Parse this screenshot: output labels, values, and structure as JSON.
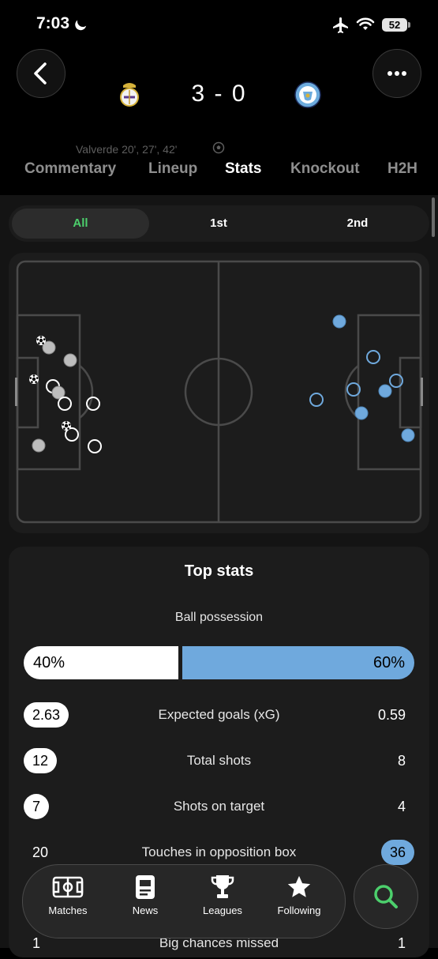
{
  "status_bar": {
    "time": "7:03",
    "battery": "52"
  },
  "match": {
    "score": "3 - 0",
    "scorers": "Valverde 20', 27', 42'"
  },
  "tabs": [
    "Commentary",
    "Lineup",
    "Stats",
    "Knockout",
    "H2H"
  ],
  "active_tab": "Stats",
  "periods": [
    "All",
    "1st",
    "2nd"
  ],
  "active_period": "All",
  "top_stats": {
    "title": "Top stats",
    "possession": {
      "label": "Ball possession",
      "home": "40%",
      "away": "60%",
      "home_fraction": 0.4
    },
    "rows": [
      {
        "label": "Expected goals (xG)",
        "home": "2.63",
        "away": "0.59"
      },
      {
        "label": "Total shots",
        "home": "12",
        "away": "8"
      },
      {
        "label": "Shots on target",
        "home": "7",
        "away": "4"
      },
      {
        "label": "Touches in opposition box",
        "home": "20",
        "away": "36"
      },
      {
        "label": "Big chances missed",
        "home": "1",
        "away": "1"
      }
    ]
  },
  "nav": {
    "items": [
      {
        "label": "Matches",
        "icon": "pitch-icon"
      },
      {
        "label": "News",
        "icon": "news-icon"
      },
      {
        "label": "Leagues",
        "icon": "trophy-icon"
      },
      {
        "label": "Following",
        "icon": "star-icon"
      }
    ],
    "search_icon": "search-icon"
  },
  "colors": {
    "accent_green": "#4ccf6c",
    "away_blue": "#6fa9dd",
    "home_white": "#ffffff"
  }
}
